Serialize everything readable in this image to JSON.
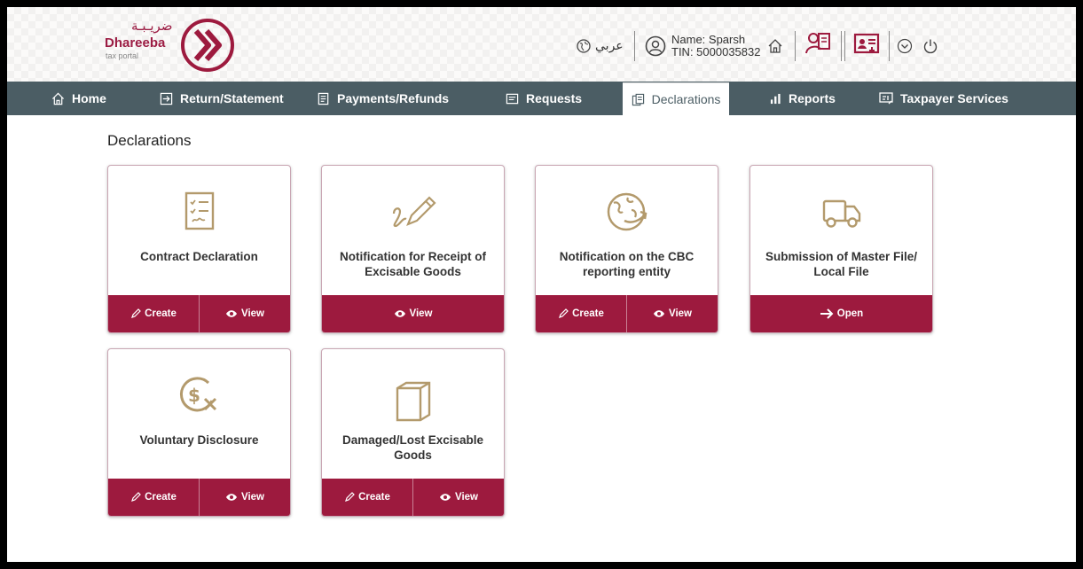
{
  "header": {
    "logo_arabic": "ضريـبـة",
    "logo_brand": "Dhareeba",
    "logo_sub": "tax portal",
    "language_label": "عربي",
    "user_name": "Name: Sparsh",
    "user_tin": "TIN: 5000035832"
  },
  "nav": {
    "items": [
      {
        "label": "Home",
        "icon": "home-icon"
      },
      {
        "label": "Return/Statement",
        "icon": "return-icon"
      },
      {
        "label": "Payments/Refunds",
        "icon": "payments-icon"
      },
      {
        "label": "Requests",
        "icon": "requests-icon"
      },
      {
        "label": "Declarations",
        "icon": "declarations-icon",
        "active": true
      },
      {
        "label": "Reports",
        "icon": "bar-chart-icon"
      },
      {
        "label": "Taxpayer Services",
        "icon": "services-icon"
      }
    ]
  },
  "page": {
    "title": "Declarations"
  },
  "cards": [
    {
      "title": "Contract Declaration",
      "icon": "checklist-icon",
      "buttons": [
        "Create",
        "View"
      ]
    },
    {
      "title": "Notification for Receipt of Excisable Goods",
      "icon": "signature-pen-icon",
      "buttons": [
        "View"
      ]
    },
    {
      "title": "Notification on the CBC reporting entity",
      "icon": "globe-arrow-icon",
      "buttons": [
        "Create",
        "View"
      ]
    },
    {
      "title": "Submission of Master File/ Local File",
      "icon": "truck-icon",
      "buttons": [
        "Open"
      ]
    },
    {
      "title": "Voluntary Disclosure",
      "icon": "dollar-x-icon",
      "buttons": [
        "Create",
        "View"
      ]
    },
    {
      "title": "Damaged/Lost Excisable Goods",
      "icon": "box-icon",
      "buttons": [
        "Create",
        "View"
      ]
    }
  ],
  "colors": {
    "brand": "#9d1a3e",
    "nav_bg": "#4b5d64",
    "icon_gold": "#b39a6c"
  }
}
